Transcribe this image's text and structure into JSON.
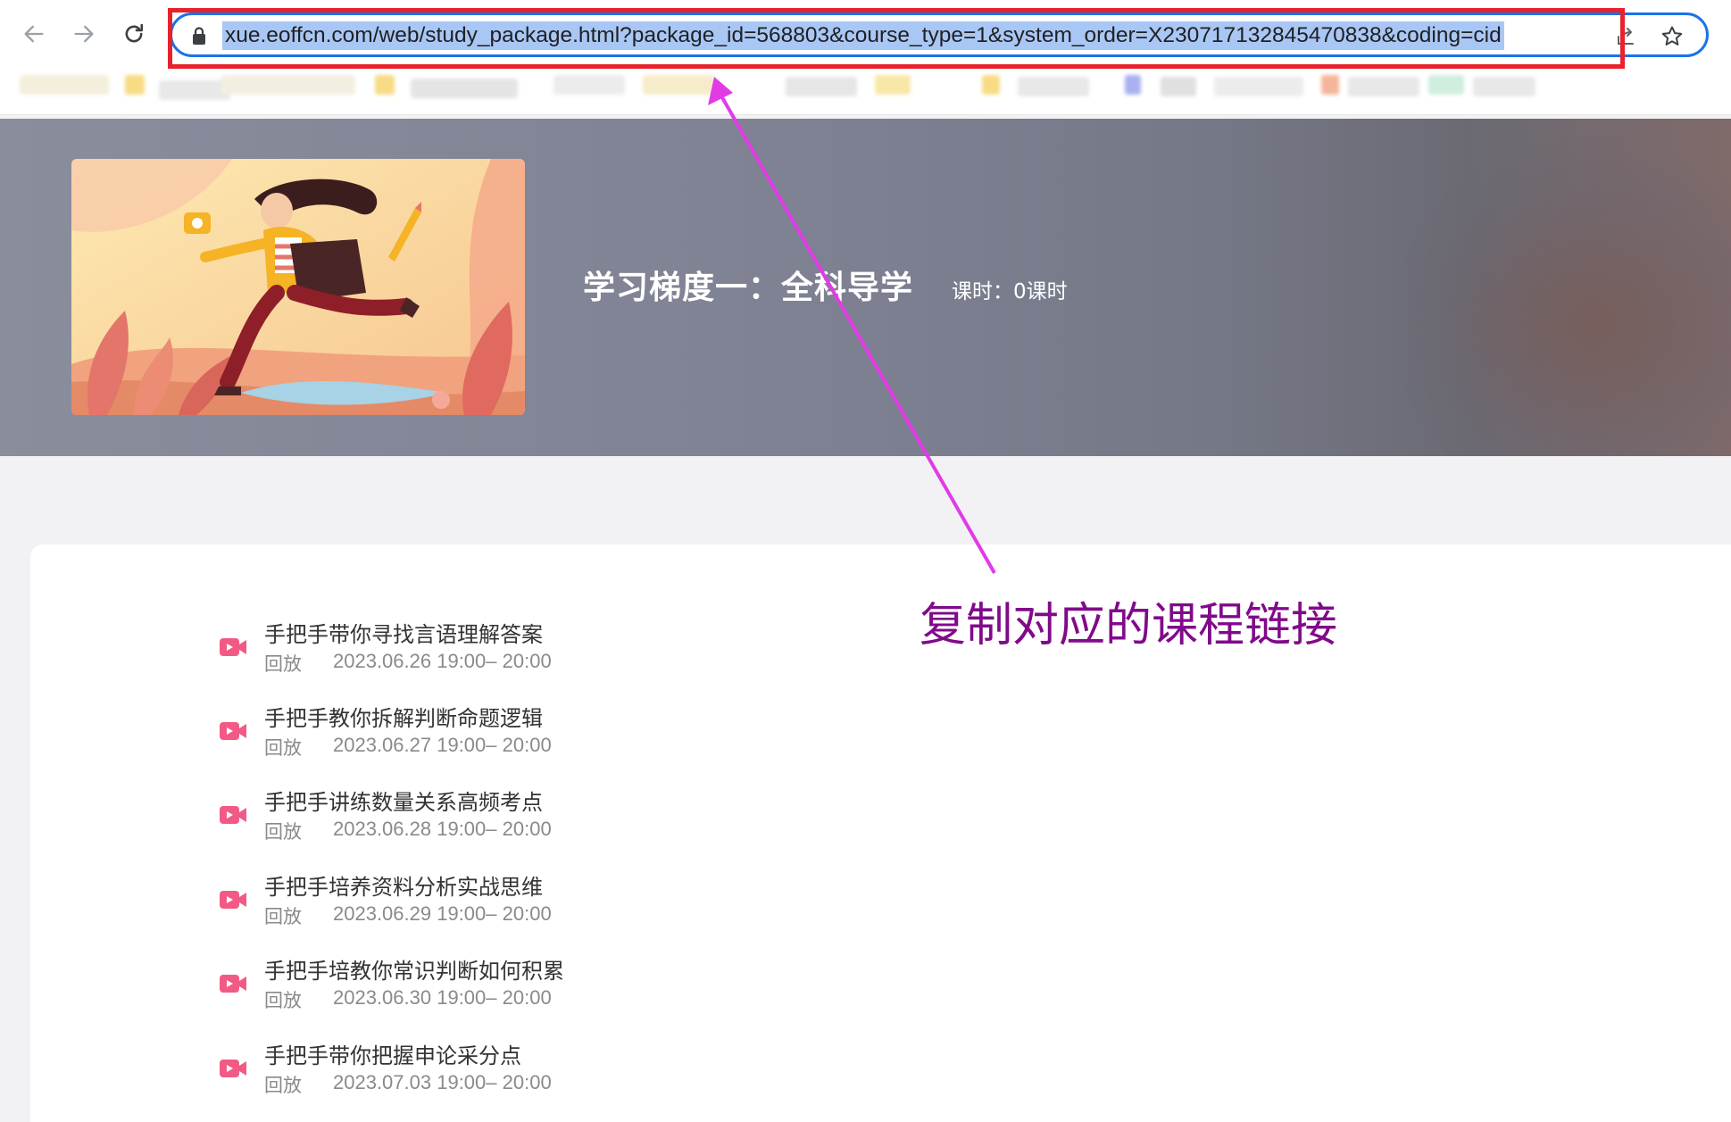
{
  "browser": {
    "url": "xue.eoffcn.com/web/study_package.html?package_id=568803&course_type=1&system_order=X230717132845470838&coding=cid"
  },
  "hero": {
    "title": "学习梯度一：全科导学",
    "hours": "课时：0课时"
  },
  "lessons": [
    {
      "title": "手把手带你寻找言语理解答案",
      "tag": "回放",
      "time": "2023.06.26 19:00– 20:00"
    },
    {
      "title": "手把手教你拆解判断命题逻辑",
      "tag": "回放",
      "time": "2023.06.27 19:00– 20:00"
    },
    {
      "title": "手把手讲练数量关系高频考点",
      "tag": "回放",
      "time": "2023.06.28 19:00– 20:00"
    },
    {
      "title": "手把手培养资料分析实战思维",
      "tag": "回放",
      "time": "2023.06.29 19:00– 20:00"
    },
    {
      "title": "手把手培教你常识判断如何积累",
      "tag": "回放",
      "time": "2023.06.30 19:00– 20:00"
    },
    {
      "title": "手把手带你把握申论采分点",
      "tag": "回放",
      "time": "2023.07.03 19:00– 20:00"
    }
  ],
  "annotation": {
    "text": "复制对应的课程链接"
  },
  "colors": {
    "accent": "#1a73e8",
    "highlight_box": "#e8222c",
    "annotation": "#800a8a",
    "arrow": "#e23be6",
    "play_icon": "#f25a86"
  }
}
